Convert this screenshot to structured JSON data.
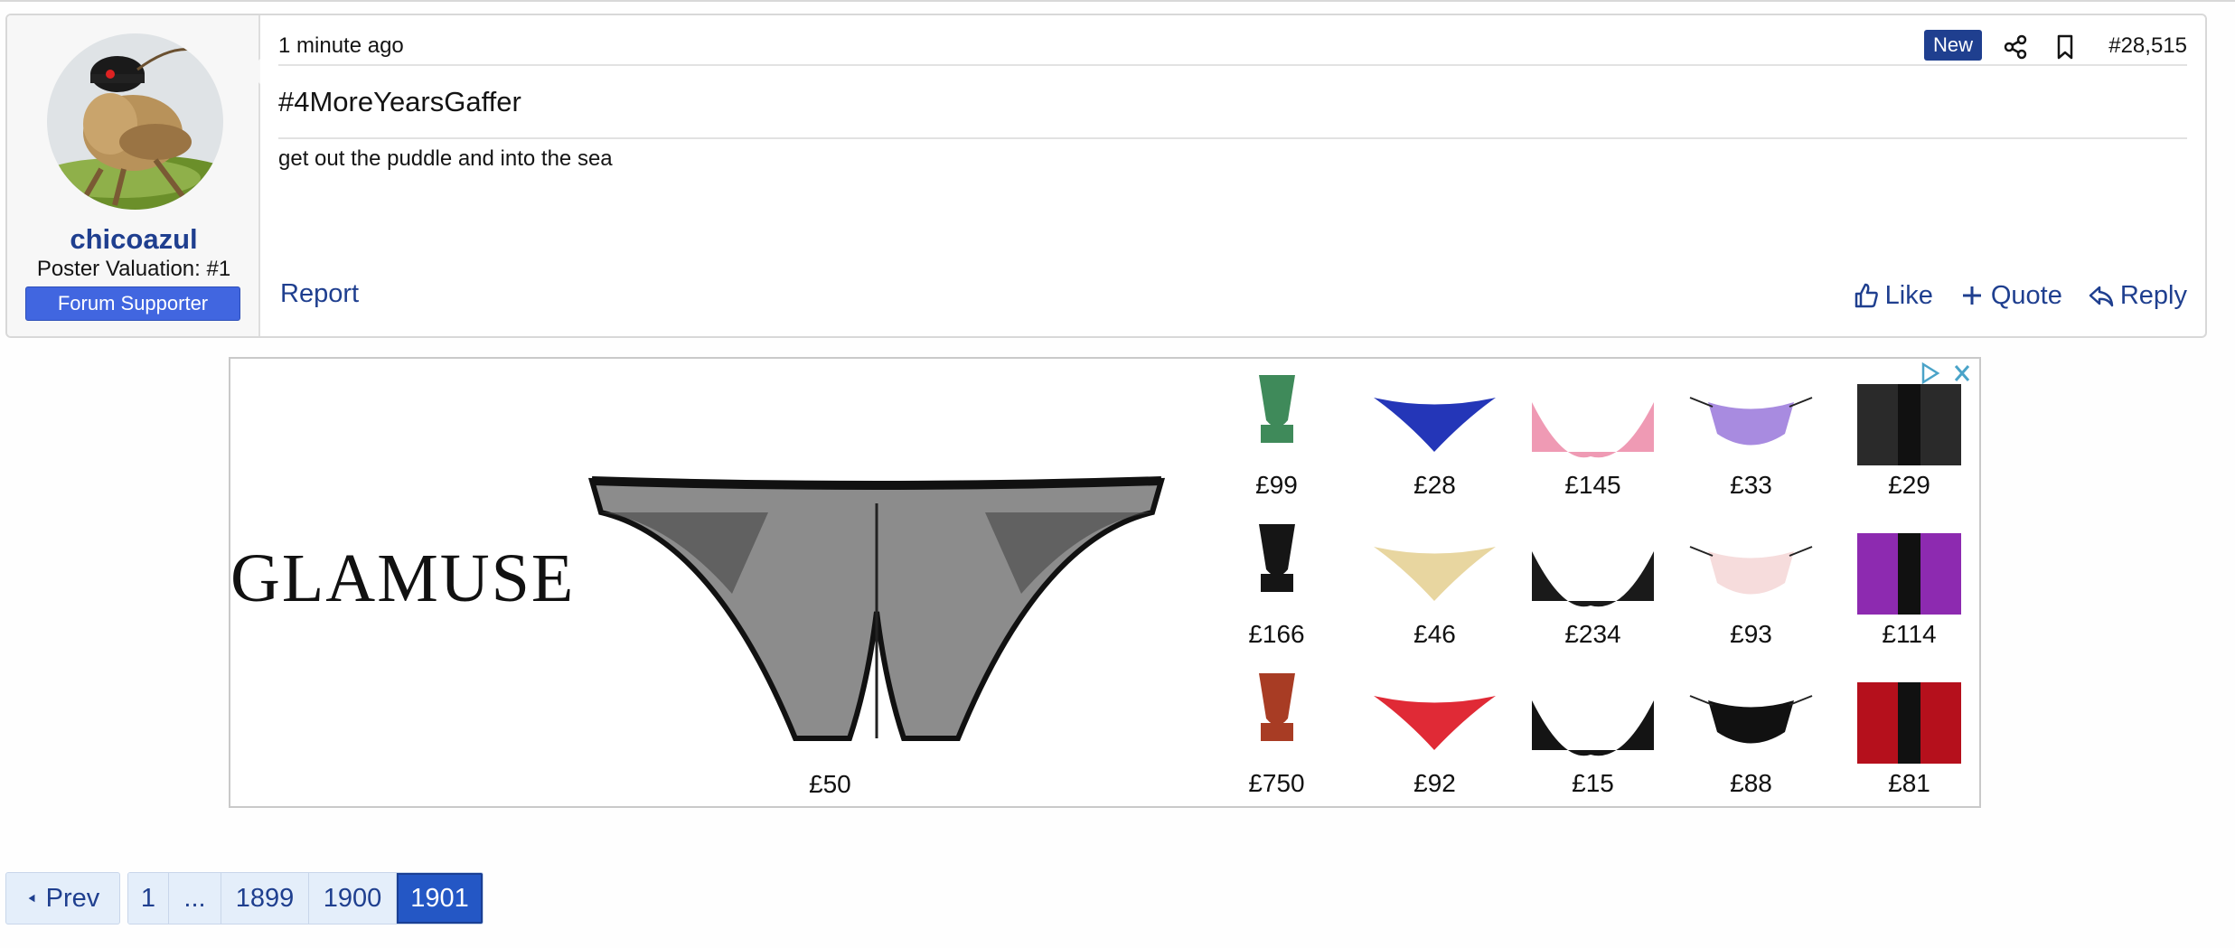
{
  "post": {
    "time": "1 minute ago",
    "new_badge": "New",
    "post_number": "#28,515",
    "title": "#4MoreYearsGaffer",
    "body": "get out the puddle and into the sea",
    "report_label": "Report",
    "actions": {
      "like": "Like",
      "quote": "Quote",
      "reply": "Reply"
    }
  },
  "user": {
    "name": "chicoazul",
    "title": "Poster Valuation: #1",
    "banner": "Forum Supporter"
  },
  "ad": {
    "brand": "GLAMUSE",
    "hero_price": "£50",
    "products": [
      {
        "price": "£99",
        "color": "#3f8a5a"
      },
      {
        "price": "£28",
        "color": "#2436b8"
      },
      {
        "price": "£145",
        "color": "#ef9ab4"
      },
      {
        "price": "£33",
        "color": "#a88be0"
      },
      {
        "price": "£29",
        "color": "#2a2a2a"
      },
      {
        "price": "£166",
        "color": "#151515"
      },
      {
        "price": "£46",
        "color": "#e8d6a0"
      },
      {
        "price": "£234",
        "color": "#1a1a1a"
      },
      {
        "price": "£93",
        "color": "#f6dcdc"
      },
      {
        "price": "£114",
        "color": "#8d2ab0"
      },
      {
        "price": "£750",
        "color": "#a83c24"
      },
      {
        "price": "£92",
        "color": "#e02a36"
      },
      {
        "price": "£15",
        "color": "#141414"
      },
      {
        "price": "£88",
        "color": "#111111"
      },
      {
        "price": "£81",
        "color": "#b5101c"
      }
    ]
  },
  "pagination": {
    "prev_label": "Prev",
    "pages": [
      "1",
      "...",
      "1899",
      "1900",
      "1901"
    ],
    "current": "1901"
  },
  "colors": {
    "accent": "#1f3f8f",
    "banner": "#4166e0",
    "current_page": "#2457c5"
  }
}
